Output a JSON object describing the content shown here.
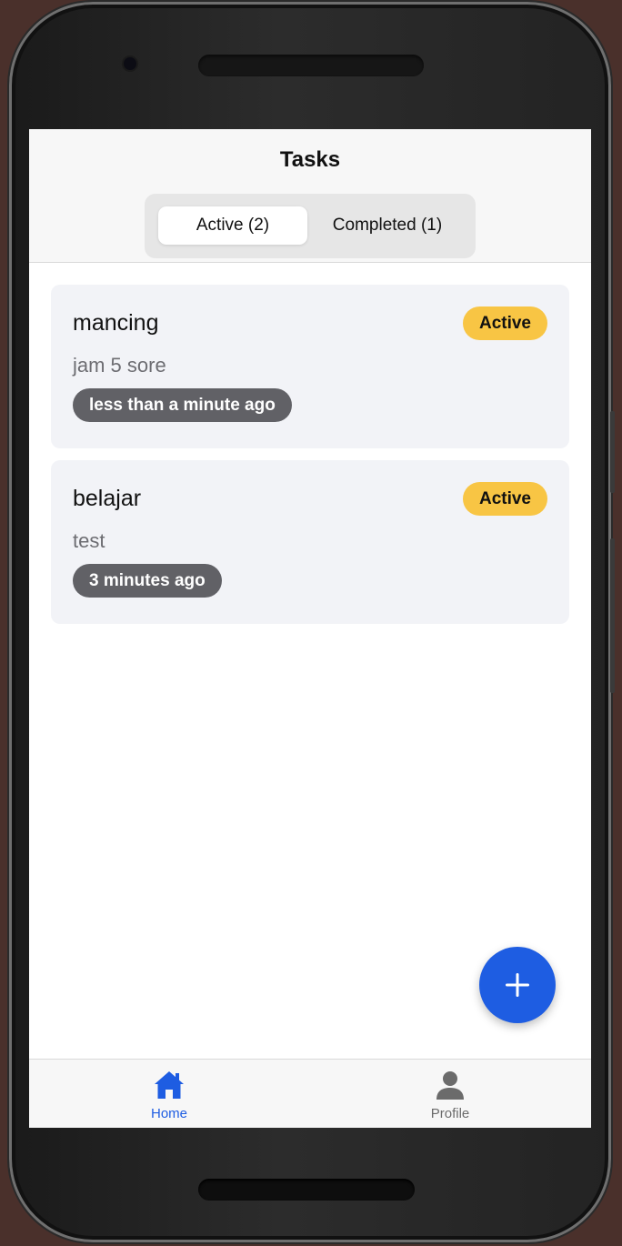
{
  "header": {
    "title": "Tasks"
  },
  "filter_tabs": [
    {
      "label": "Active (2)",
      "selected": true
    },
    {
      "label": "Completed (1)",
      "selected": false
    }
  ],
  "tasks": [
    {
      "title": "mancing",
      "description": "jam 5 sore",
      "time": "less than a minute ago",
      "status": "Active"
    },
    {
      "title": "belajar",
      "description": "test",
      "time": "3 minutes ago",
      "status": "Active"
    }
  ],
  "fab": {
    "icon": "plus-icon"
  },
  "tab_bar": {
    "items": [
      {
        "label": "Home",
        "icon": "home-icon",
        "selected": true
      },
      {
        "label": "Profile",
        "icon": "person-icon",
        "selected": false
      }
    ]
  },
  "colors": {
    "accent": "#1e5de2",
    "status_active": "#f8c544",
    "time_pill": "#616166",
    "card_bg": "#f2f3f7"
  }
}
